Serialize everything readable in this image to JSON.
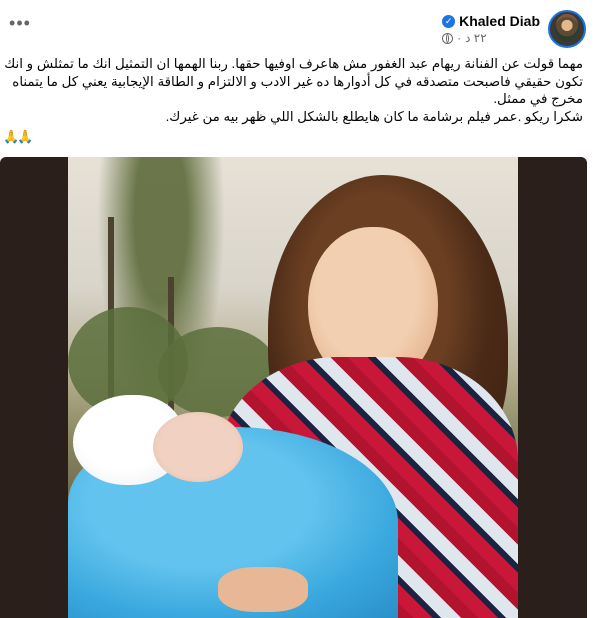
{
  "post": {
    "author": "Khaled Diab",
    "time": "٢٢ د",
    "more_label": "•••",
    "text_lines": [
      "مهما قولت عن الفنانة ريهام عبد الغفور مش هاعرف اوفيها حقها. ربنا الهمها ان التمثيل انك ما تمثلش و انك",
      "تكون حقيقي فاصبحت متصدقه في كل أدوارها ده غير الادب و الالتزام و الطاقة الإيجابية يعني كل ما يتمناه",
      "مخرج في ممثل.",
      "شكرا ريكو .عمر فيلم برشامة ما كان هايطلع بالشكل اللي ظهر بيه من غيرك."
    ],
    "emoji": "🙏🙏"
  },
  "icons": {
    "verified": "verified-badge-icon",
    "globe": "globe-icon",
    "more": "more-options-icon"
  },
  "colors": {
    "accent": "#1b74e4",
    "secondary_text": "#65676b",
    "media_background": "#2b1f1c"
  }
}
